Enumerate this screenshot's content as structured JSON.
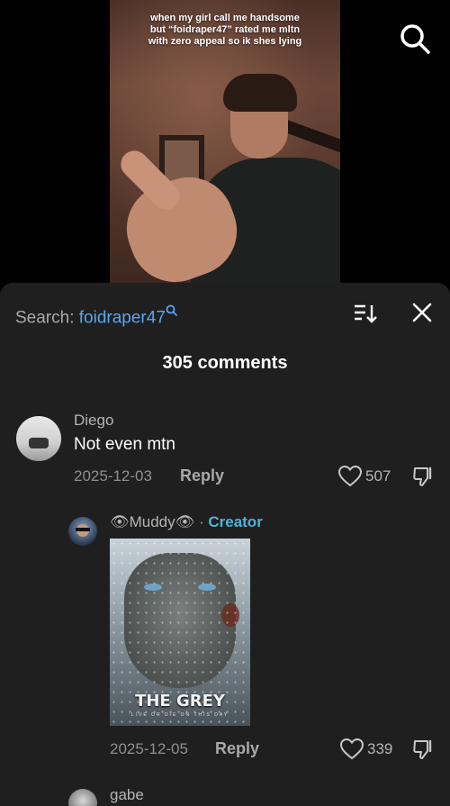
{
  "video": {
    "caption": "when my girl call me handsome but “foidraper47” rated me mltn with zero appeal so ik shes lying"
  },
  "sheet": {
    "search_prefix": "Search: ",
    "search_term": "foidraper47",
    "comment_count": "305 comments"
  },
  "comments": [
    {
      "author": "Diego",
      "text": "Not even mtn",
      "date": "2025-12-03",
      "reply_label": "Reply",
      "likes": "507"
    },
    {
      "author": "👁Muddy👁",
      "separator": "·",
      "badge": "Creator",
      "image_title": "THE GREY",
      "image_tagline": "LIVE OR DIE ON THIS DAY",
      "date": "2025-12-05",
      "reply_label": "Reply",
      "likes": "339"
    },
    {
      "author": "gabe"
    }
  ],
  "colors": {
    "sheet_bg": "#1f1f1f",
    "search_term": "#5aa6f0",
    "creator_badge": "#4fb3d9"
  },
  "icons": [
    "search-icon",
    "sort-icon",
    "close-icon",
    "heart-icon",
    "dislike-icon"
  ]
}
